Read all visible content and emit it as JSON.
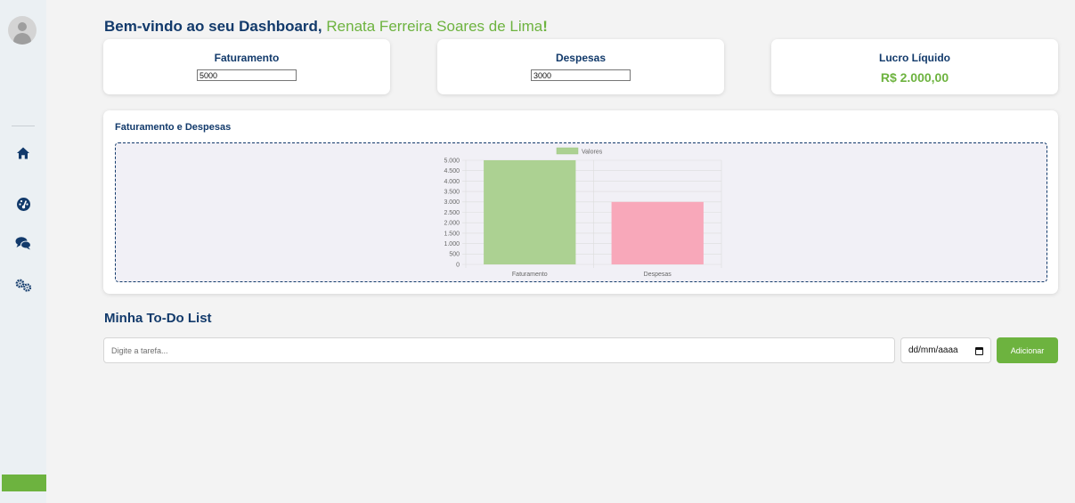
{
  "header": {
    "welcome_prefix": "Bem-vindo ao seu Dashboard, ",
    "user_name": "Renata Ferreira Soares de Lima",
    "welcome_suffix": "!"
  },
  "sidebar": {
    "icons": [
      "home-icon",
      "dashboard-icon",
      "chat-icon",
      "settings-icon"
    ],
    "accent_color": "#6db33f"
  },
  "cards": {
    "faturamento": {
      "label": "Faturamento",
      "value": "5000"
    },
    "despesas": {
      "label": "Despesas",
      "value": "3000"
    },
    "lucro": {
      "label": "Lucro Líquido",
      "value": "R$ 2.000,00"
    }
  },
  "chart": {
    "title": "Faturamento e Despesas"
  },
  "chart_data": {
    "type": "bar",
    "categories": [
      "Faturamento",
      "Despesas"
    ],
    "series": [
      {
        "name": "Valores",
        "values": [
          5000,
          3000
        ]
      }
    ],
    "bar_colors": [
      "#acd192",
      "#f8a8ba"
    ],
    "legend_color": "#acd192",
    "legend_position": "top",
    "ylim": [
      0,
      5000
    ],
    "yticks": [
      "0",
      "500",
      "1.000",
      "1.500",
      "2.000",
      "2.500",
      "3.000",
      "3.500",
      "4.000",
      "4.500",
      "5.000"
    ],
    "grid": true
  },
  "todo": {
    "title": "Minha To-Do List",
    "placeholder": "Digite a tarefa...",
    "date_placeholder": "dd/mm/aaaa",
    "add_label": "Adicionar"
  },
  "colors": {
    "primary": "#123a6b",
    "accent": "#6db33f"
  }
}
